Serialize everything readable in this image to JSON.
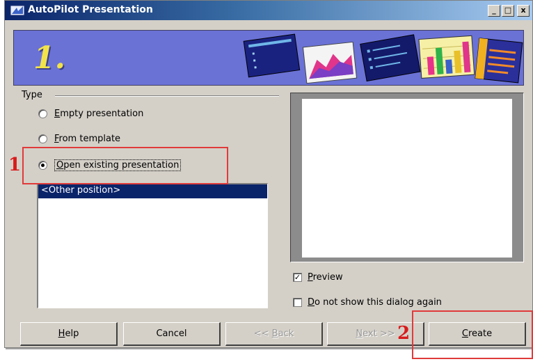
{
  "window": {
    "title": "AutoPilot Presentation",
    "controls": {
      "minimize": "_",
      "maximize": "□",
      "close": "x"
    }
  },
  "banner": {
    "step": "1."
  },
  "type_group": {
    "label": "Type",
    "options": [
      {
        "label": "Empty presentation",
        "accel": "E",
        "rest": "mpty presentation",
        "selected": false
      },
      {
        "label": "From template",
        "accel": "F",
        "rest": "rom template",
        "selected": false
      },
      {
        "label": "Open existing presentation",
        "accel": "O",
        "rest": "pen existing presentation",
        "selected": true
      }
    ]
  },
  "file_list": {
    "items": [
      "<Other position>"
    ]
  },
  "options": {
    "preview": {
      "accel": "P",
      "rest": "review",
      "checked": true
    },
    "dont_show": {
      "accel": "D",
      "rest": "o not show this dialog again",
      "checked": false
    }
  },
  "buttons": {
    "help": {
      "accel": "H",
      "rest": "elp"
    },
    "cancel": "Cancel",
    "back": {
      "pre": "<< ",
      "accel": "B",
      "rest": "ack"
    },
    "next": {
      "accel": "N",
      "rest": "ext >>"
    },
    "create": {
      "accel": "C",
      "rest": "reate"
    }
  },
  "annotations": {
    "one": "1",
    "two": "2",
    "color": "#e03a3a"
  }
}
